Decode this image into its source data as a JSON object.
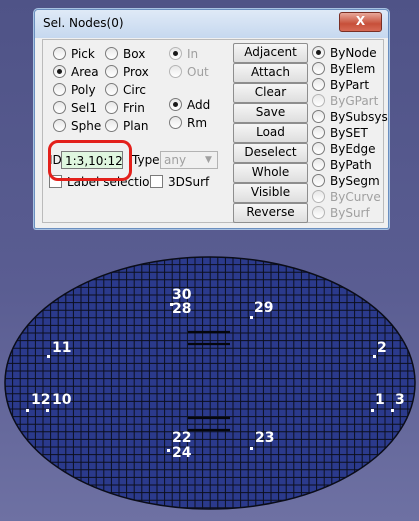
{
  "dialog": {
    "title": "Sel. Nodes(0)",
    "close_symbol": "X",
    "left_radios": [
      {
        "label": "Pick",
        "checked": false
      },
      {
        "label": "Area",
        "checked": true
      },
      {
        "label": "Poly",
        "checked": false
      },
      {
        "label": "Sel1",
        "checked": false
      },
      {
        "label": "Sphe",
        "checked": false
      }
    ],
    "mid_radios": [
      {
        "label": "Box",
        "checked": false
      },
      {
        "label": "Prox",
        "checked": false
      },
      {
        "label": "Circ",
        "checked": false
      },
      {
        "label": "Frin",
        "checked": false
      },
      {
        "label": "Plan",
        "checked": false
      }
    ],
    "inout_radios": [
      {
        "label": "In",
        "checked": true,
        "disabled": true
      },
      {
        "label": "Out",
        "checked": false,
        "disabled": true
      }
    ],
    "addrm_radios": [
      {
        "label": "Add",
        "checked": true
      },
      {
        "label": "Rm",
        "checked": false
      }
    ],
    "buttons": [
      "Adjacent",
      "Attach",
      "Clear",
      "Save",
      "Load",
      "Deselect",
      "Whole",
      "Visible",
      "Reverse"
    ],
    "by_radios": [
      {
        "label": "ByNode",
        "checked": true,
        "disabled": false
      },
      {
        "label": "ByElem",
        "checked": false,
        "disabled": false
      },
      {
        "label": "ByPart",
        "checked": false,
        "disabled": false
      },
      {
        "label": "ByGPart",
        "checked": false,
        "disabled": true
      },
      {
        "label": "BySubsys",
        "checked": false,
        "disabled": false
      },
      {
        "label": "BySET",
        "checked": false,
        "disabled": false
      },
      {
        "label": "ByEdge",
        "checked": false,
        "disabled": false
      },
      {
        "label": "ByPath",
        "checked": false,
        "disabled": false
      },
      {
        "label": "BySegm",
        "checked": false,
        "disabled": false
      },
      {
        "label": "ByCurve",
        "checked": false,
        "disabled": true
      },
      {
        "label": "BySurf",
        "checked": false,
        "disabled": true
      }
    ],
    "id_label": "ID",
    "id_value": "1:3,10:12",
    "type_label": "Type",
    "type_value": "any",
    "label_selection": "Label selection",
    "surf3d": "3DSurf"
  },
  "colors": {
    "mesh_fill": "#2b3a8c",
    "mesh_line": "#0c0f1e",
    "highlight": "#e3201b",
    "id_field_bg": "#dff7df"
  },
  "viewport": {
    "node_labels": [
      "30",
      "28",
      "29",
      "11",
      "2",
      "12",
      "10",
      "1",
      "3",
      "22",
      "24",
      "23"
    ]
  }
}
